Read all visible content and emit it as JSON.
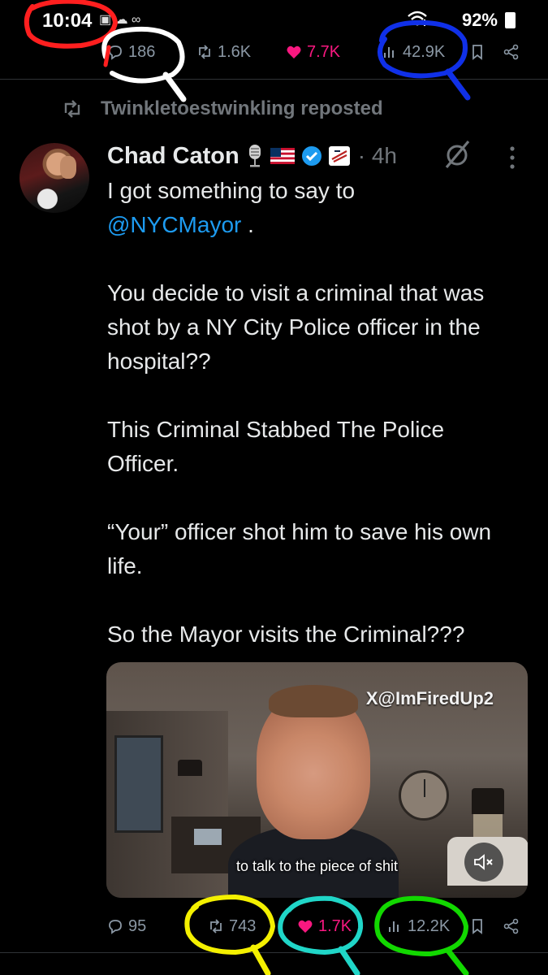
{
  "status_bar": {
    "time": "10:04",
    "battery": "92%"
  },
  "top_actions": {
    "replies": "186",
    "reposts": "1.6K",
    "likes": "7.7K",
    "views": "42.9K"
  },
  "repost_header": {
    "text": "Twinkletoestwinkling reposted"
  },
  "post": {
    "author": "Chad Caton",
    "time": "· 4h",
    "body_line1": "I got something to say to",
    "mention": "@NYCMayor",
    "mention_suffix": " .",
    "para2": "You decide to visit a criminal that was shot by a NY City Police officer in the hospital??",
    "para3": "This Criminal Stabbed The Police Officer.",
    "para4": "“Your” officer shot him to save his own life.",
    "para5": "So the Mayor visits the Criminal???"
  },
  "media": {
    "watermark": "X@ImFiredUp2",
    "caption": "to talk to the piece of shit"
  },
  "bottom_actions": {
    "replies": "95",
    "reposts": "743",
    "likes": "1.7K",
    "views": "12.2K"
  },
  "colors": {
    "accent": "#1d9bf0",
    "like": "#f91880",
    "muted": "#71767b",
    "marker_red": "#ff1f1f",
    "marker_white": "#ffffff",
    "marker_blue": "#1030e8",
    "marker_yellow": "#f4f000",
    "marker_cyan": "#20d6c8",
    "marker_green": "#12d800"
  },
  "icons": [
    "reply-icon",
    "repost-icon",
    "heart-icon",
    "views-icon",
    "bookmark-icon",
    "share-icon",
    "verified-icon",
    "mute-icon",
    "more-icon",
    "grok-icon"
  ]
}
